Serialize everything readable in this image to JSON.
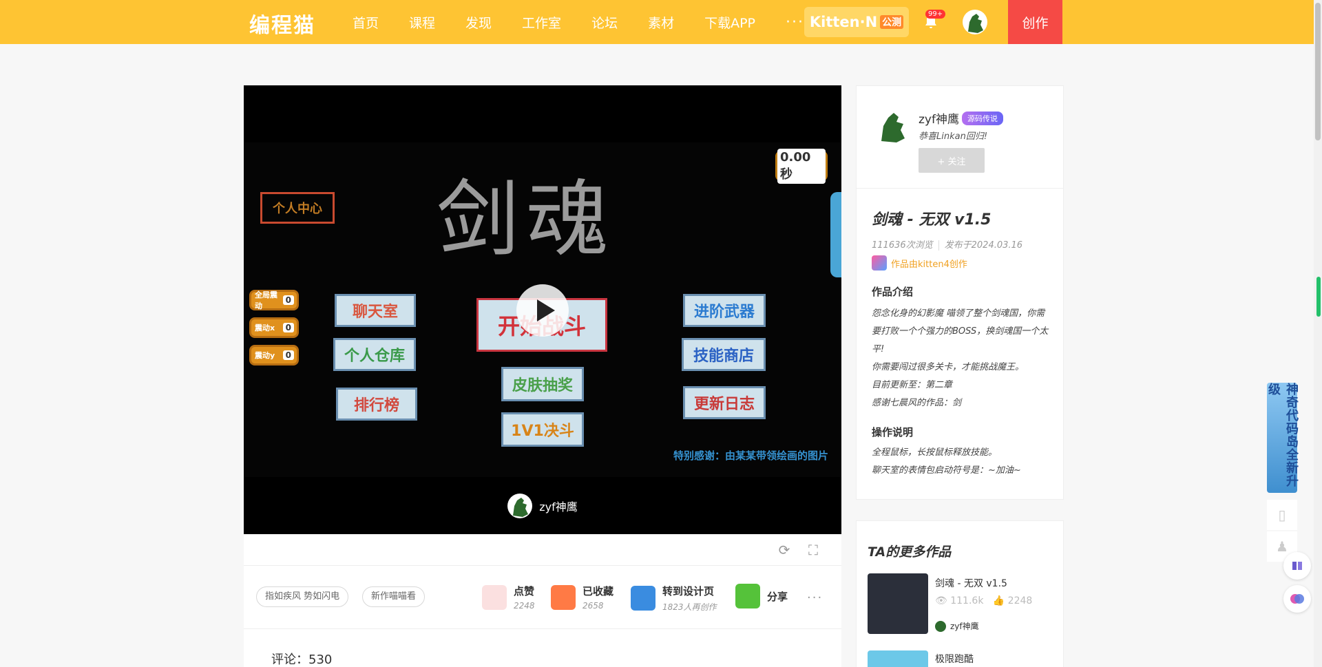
{
  "header": {
    "logo": "编程猫",
    "nav": [
      "首页",
      "课程",
      "发现",
      "工作室",
      "论坛",
      "素材",
      "下载APP"
    ],
    "more": "···",
    "kitten_n": "Kitten·N",
    "kitten_n_tag": "公测",
    "notification_count": "99+",
    "create_label": "创作"
  },
  "player": {
    "game_title": "剑魂",
    "timer": "0.00秒",
    "buttons": {
      "personal_center": "个人中心",
      "chat": "聊天室",
      "warehouse": "个人仓库",
      "ranking": "排行榜",
      "start_battle": "开始战斗",
      "skin_draw": "皮肤抽奖",
      "duel": "1V1决斗",
      "advanced_weapon": "进阶武器",
      "skill_shop": "技能商店",
      "update_log": "更新日志",
      "global_counter": "全局震动",
      "counter_x": "震动x",
      "counter_y": "震动y",
      "counter_value": "0"
    },
    "credit": "特别感谢：由某某带领绘画的图片",
    "author": "zyf神鹰"
  },
  "actions": {
    "tags": [
      "指如疾风 势如闪电",
      "新作喵喵看"
    ],
    "like_label": "点赞",
    "like_count": "2248",
    "fav_label": "已收藏",
    "fav_count": "2658",
    "remix_label": "转到设计页",
    "remix_count": "1823人再创作",
    "share_label": "分享",
    "more": "···"
  },
  "comments": {
    "label": "评论：530"
  },
  "author_card": {
    "name": "zyf神鹰",
    "badge": "源码传说",
    "signature": "恭喜Linkan回归!",
    "follow": "+ 关注"
  },
  "work": {
    "title": "剑魂 - 无双 v1.5",
    "views": "111636次浏览",
    "published": "发布于2024.03.16",
    "made_with": "作品由kitten4创作",
    "intro_title": "作品介绍",
    "intro_lines": [
      "怨念化身的幻影魔 喵领了整个剑魂国，你需要打败一个个强力的BOSS，换剑魂国一个太平!",
      "你需要闯过很多关卡，才能挑战魔王。",
      "目前更新至：第二章",
      "感谢七晨风的作品：剑"
    ],
    "ops_title": "操作说明",
    "ops_lines": [
      "全程鼠标，长按鼠标释放技能。",
      "聊天室的表情包启动符号是：~加油~"
    ]
  },
  "more_works": {
    "title": "TA的更多作品",
    "items": [
      {
        "title": "剑魂 - 无双 v1.5",
        "views": "111.6k",
        "likes": "2248",
        "author": "zyf神鹰"
      },
      {
        "title": "极限跑酷"
      }
    ]
  },
  "float": {
    "banner": "神奇代码岛全新升级"
  },
  "colors": {
    "header": "#fec433",
    "create": "#f54a45",
    "accent": "#f0a020"
  }
}
